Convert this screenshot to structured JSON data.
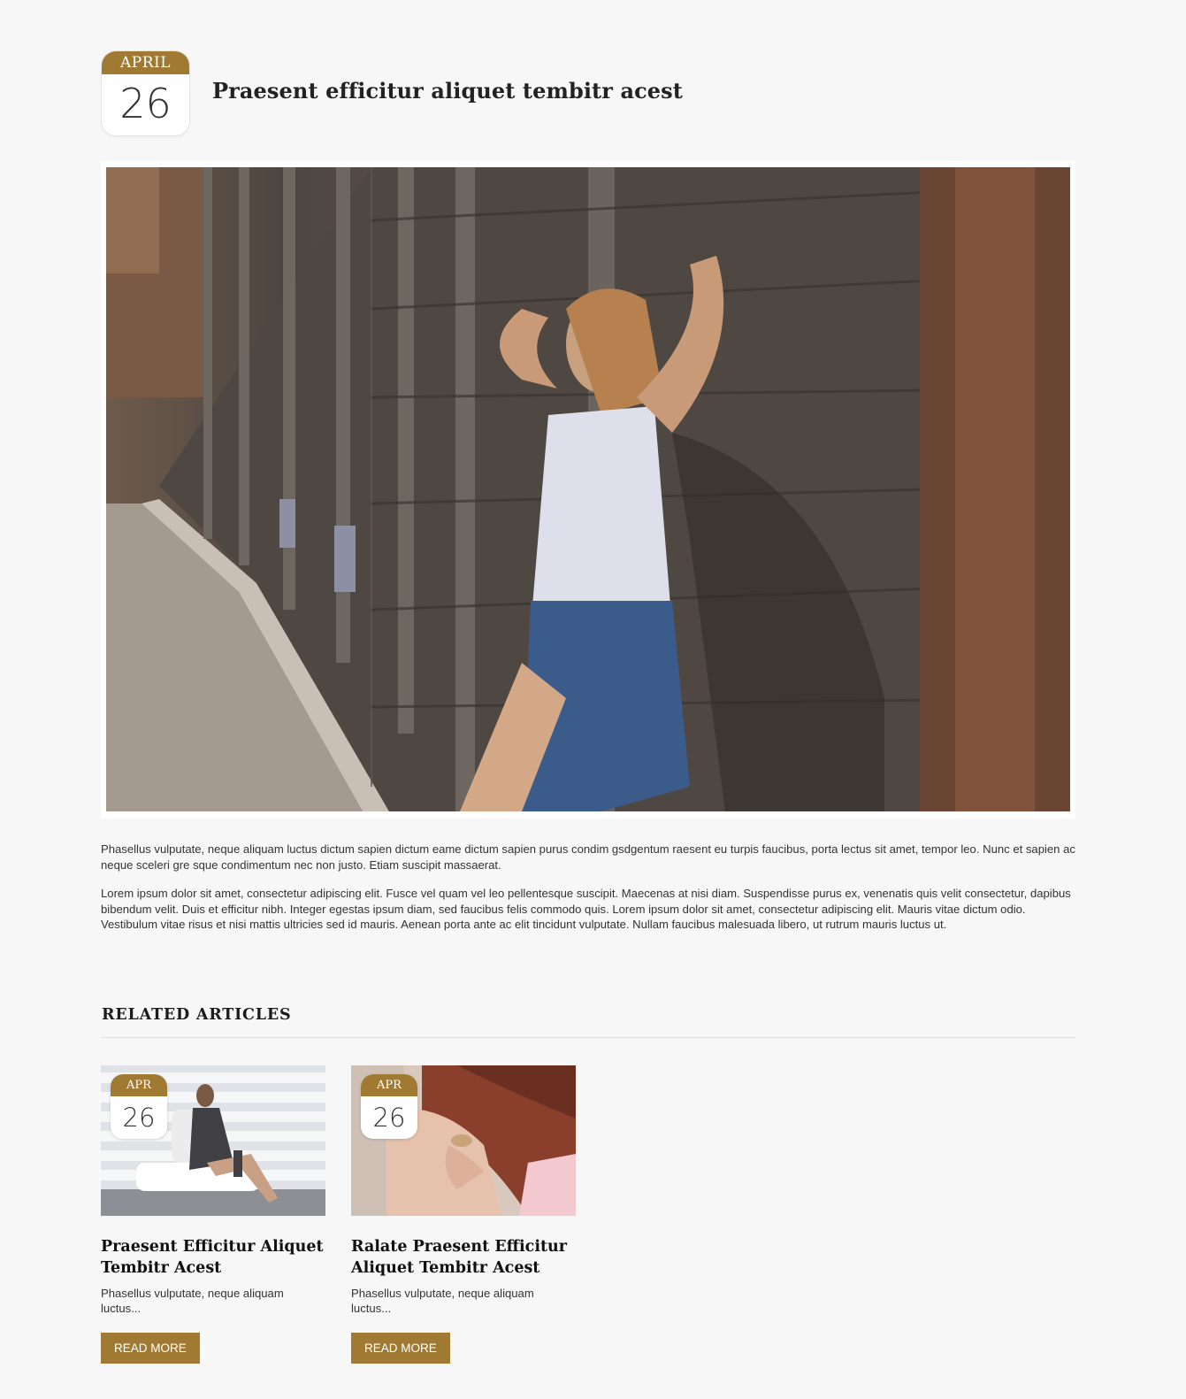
{
  "post": {
    "date_month": "APRIL",
    "date_day": "26",
    "title": "Praesent efficitur aliquet tembitr acest",
    "hero_image_alt": "woman-leaning-on-wooden-wall-photo",
    "paragraphs": [
      "Phasellus vulputate, neque aliquam luctus dictum sapien dictum eame dictum sapien purus condim gsdgentum raesent eu turpis faucibus, porta lectus sit amet, tempor leo. Nunc et sapien ac neque sceleri gre sque condimentum nec non justo. Etiam suscipit massaerat.",
      "Lorem ipsum dolor sit amet, consectetur adipiscing elit. Fusce vel quam vel leo pellentesque suscipit. Maecenas at nisi diam. Suspendisse purus ex, venenatis quis velit consectetur, dapibus bibendum velit. Duis et efficitur nibh. Integer egestas ipsum diam, sed faucibus felis commodo quis. Lorem ipsum dolor sit amet, consectetur adipiscing elit. Mauris vitae dictum odio. Vestibulum vitae risus et nisi mattis ultricies sed id mauris. Aenean porta ante ac elit tincidunt vulputate. Nullam faucibus malesuada libero, ut rutrum mauris luctus ut."
    ]
  },
  "related": {
    "heading": "RELATED ARTICLES",
    "articles": [
      {
        "month": "APR",
        "day": "26",
        "title": "Praesent Efficitur Aliquet Tembitr Acest",
        "excerpt": "Phasellus vulputate, neque aliquam luctus...",
        "button": "READ MORE"
      },
      {
        "month": "APR",
        "day": "26",
        "title": "Ralate Praesent Efficitur Aliquet Tembitr Acest",
        "excerpt": "Phasellus vulputate, neque aliquam luctus...",
        "button": "READ MORE"
      }
    ]
  },
  "colors": {
    "accent": "#a07a32",
    "background": "#f7f7f7",
    "text": "#222222"
  }
}
